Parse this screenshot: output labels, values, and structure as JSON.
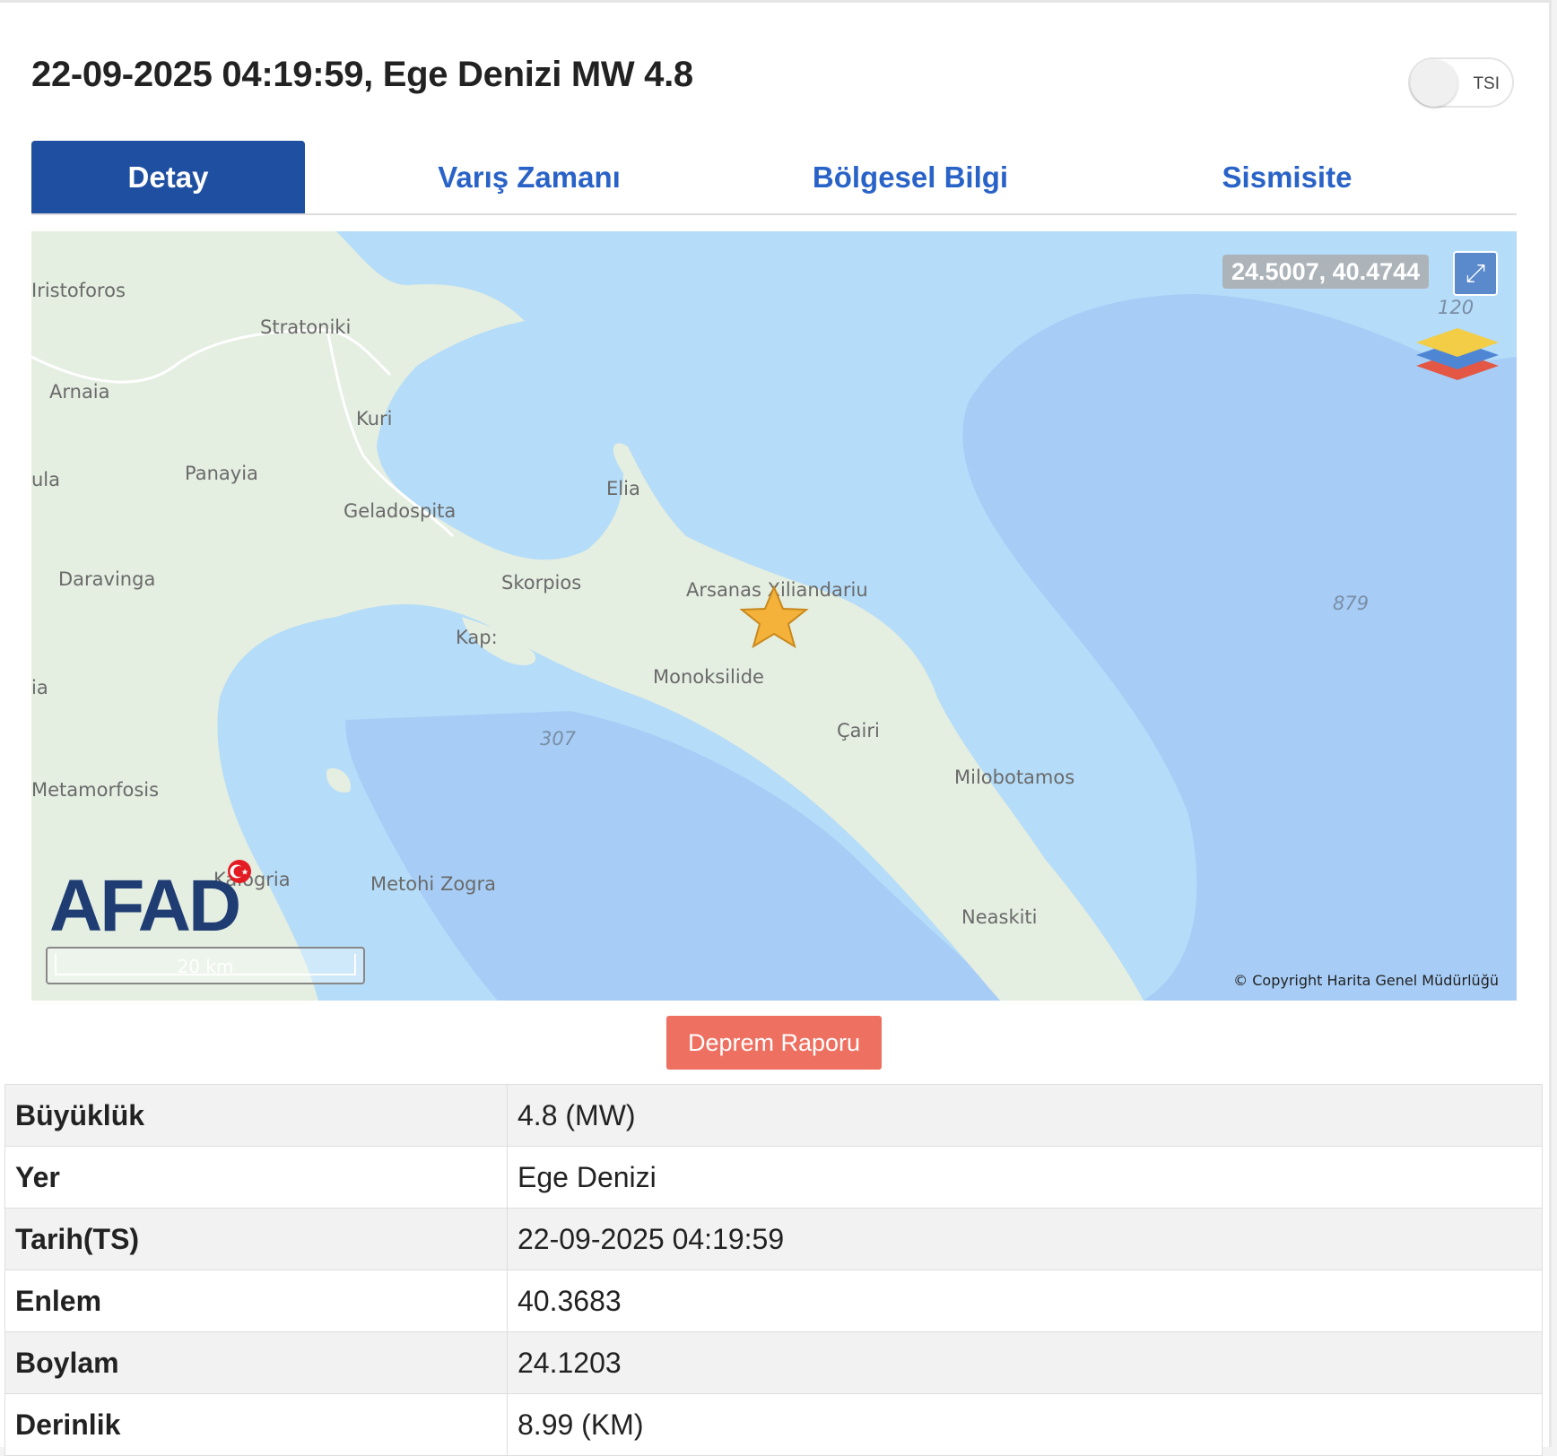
{
  "header": {
    "title": "22-09-2025 04:19:59, Ege Denizi MW 4.8"
  },
  "toggle": {
    "label": "TSI"
  },
  "tabs": [
    {
      "label": "Detay",
      "active": true
    },
    {
      "label": "Varış Zamanı",
      "active": false
    },
    {
      "label": "Bölgesel Bilgi",
      "active": false
    },
    {
      "label": "Sismisite",
      "active": false
    }
  ],
  "map": {
    "coordinates": "24.5007, 40.4744",
    "places": [
      "Iristoforos",
      "Stratoniki",
      "Arnaia",
      "Kuri",
      "ula",
      "Panayia",
      "Geladospita",
      "Elia",
      "Daravinga",
      "Skorpios",
      "Arsanas Xiliandariu",
      "Kap:",
      "Monoksilide",
      "ia",
      "Çairi",
      "Milobotamos",
      "Metamorfosis",
      "Kalogria",
      "Metohi Zogra",
      "Neaskiti"
    ],
    "depth_labels": [
      "120",
      "879",
      "307"
    ],
    "logo_text": "AFAD",
    "scale_label": "20 km",
    "copyright": "© Copyright Harita Genel Müdürlüğü",
    "icons": [
      "expand-icon",
      "layers-icon",
      "epicenter-star-icon",
      "turkish-flag-icon"
    ],
    "colors": {
      "sea": "#b5dcf8",
      "deep_sea": "#a7cdf6",
      "land": "#e4eee1",
      "star": "#f4b23a"
    }
  },
  "report_button": {
    "label": "Deprem Raporu"
  },
  "details": [
    {
      "key": "Büyüklük",
      "value": "4.8 (MW)"
    },
    {
      "key": "Yer",
      "value": "Ege Denizi"
    },
    {
      "key": "Tarih(TS)",
      "value": "22-09-2025 04:19:59"
    },
    {
      "key": "Enlem",
      "value": "40.3683"
    },
    {
      "key": "Boylam",
      "value": "24.1203"
    },
    {
      "key": "Derinlik",
      "value": "8.99 (KM)"
    }
  ]
}
